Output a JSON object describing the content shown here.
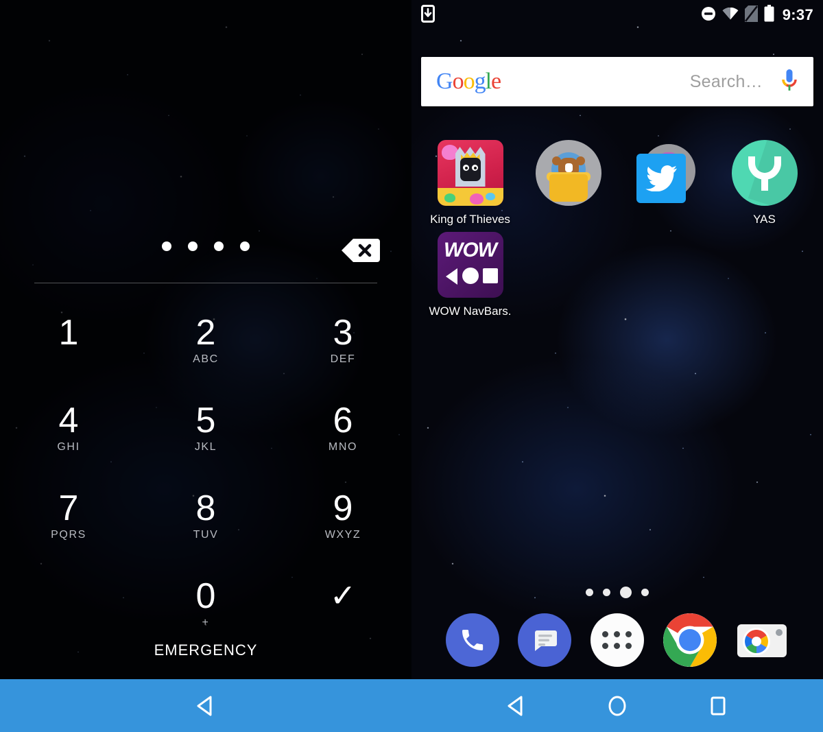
{
  "screen": {
    "left_pane": "lockscreen-pin",
    "right_pane": "home-screen"
  },
  "status_bar": {
    "download_icon": "download-icon",
    "dnd_icon": "do-not-disturb-icon",
    "wifi_icon": "wifi-icon",
    "no_sim_icon": "no-sim-icon",
    "battery_icon": "battery-icon",
    "time": "9:37"
  },
  "search": {
    "logo_letters": [
      "G",
      "o",
      "o",
      "g",
      "l",
      "e"
    ],
    "placeholder": "Search…",
    "mic_icon": "microphone-icon"
  },
  "home": {
    "apps": [
      {
        "label": "King of Thieves",
        "icon": "king-of-thieves-icon"
      },
      {
        "label": "",
        "icon": "bear-pot-icon"
      },
      {
        "label": "",
        "icon": "twitter-icon"
      },
      {
        "label": "YAS",
        "icon": "yas-icon"
      },
      {
        "label": "WOW NavBars.",
        "icon": "wow-navbars-icon"
      }
    ],
    "page_dots": {
      "count": 4,
      "active_index": 2
    },
    "dock": [
      {
        "label": "Phone",
        "icon": "phone-icon"
      },
      {
        "label": "Messages",
        "icon": "messages-icon"
      },
      {
        "label": "All apps",
        "icon": "app-drawer-icon"
      },
      {
        "label": "Chrome",
        "icon": "chrome-icon"
      },
      {
        "label": "Camera",
        "icon": "camera-icon"
      }
    ]
  },
  "lockscreen": {
    "pin_entered_count": 4,
    "backspace_icon": "backspace-icon",
    "keys": [
      {
        "num": "1",
        "sub": ""
      },
      {
        "num": "2",
        "sub": "ABC"
      },
      {
        "num": "3",
        "sub": "DEF"
      },
      {
        "num": "4",
        "sub": "GHI"
      },
      {
        "num": "5",
        "sub": "JKL"
      },
      {
        "num": "6",
        "sub": "MNO"
      },
      {
        "num": "7",
        "sub": "PQRS"
      },
      {
        "num": "8",
        "sub": "TUV"
      },
      {
        "num": "9",
        "sub": "WXYZ"
      },
      {
        "num": "0",
        "sub": "+"
      }
    ],
    "confirm_icon": "✓",
    "emergency_label": "EMERGENCY"
  },
  "navbar": {
    "color": "#3694dc",
    "left_buttons": [
      "back-icon"
    ],
    "right_buttons": [
      "back-icon",
      "home-icon",
      "recents-icon"
    ]
  },
  "colors": {
    "navbar_blue": "#3694dc",
    "google_blue": "#4285F4",
    "google_red": "#EA4335",
    "google_yellow": "#FBBC05",
    "google_green": "#34A853",
    "twitter_blue": "#1da1f2",
    "yas_green": "#4fd8b2",
    "wow_purple": "#5c1a78"
  }
}
